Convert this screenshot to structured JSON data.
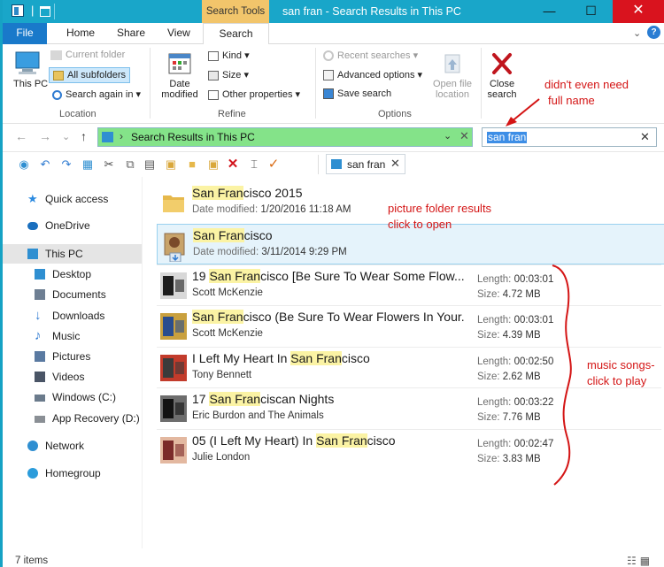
{
  "titlebar": {
    "context_tab": "Search Tools",
    "title": "san fran - Search Results in This PC",
    "minimize": "—",
    "maximize": "☐",
    "close": "✕"
  },
  "tabs": {
    "file": "File",
    "home": "Home",
    "share": "Share",
    "view": "View",
    "search": "Search",
    "expand": "⌄",
    "help": "?"
  },
  "ribbon": {
    "location": {
      "this_pc": "This PC",
      "this_pc_line2": "PC",
      "current_folder": "Current folder",
      "all_subfolders": "All subfolders",
      "search_again_in": "Search again in",
      "label": "Location"
    },
    "refine": {
      "date_modified": "Date",
      "date_modified_2": "modified",
      "kind": "Kind",
      "size": "Size",
      "other_properties": "Other properties",
      "label": "Refine"
    },
    "options": {
      "recent_searches": "Recent searches",
      "advanced_options": "Advanced options",
      "save_search": "Save search",
      "open_file_location": "Open file",
      "open_file_location_2": "location",
      "label": "Options"
    },
    "close": {
      "close_search": "Close",
      "close_search_2": "search"
    }
  },
  "address": {
    "path": "Search Results in This PC",
    "search_value": "san fran"
  },
  "doc_tab": {
    "label": "san fran"
  },
  "nav": {
    "items": [
      {
        "label": "Quick access",
        "icon": "star-icon",
        "color": "#2b8ae0"
      },
      {
        "label": "OneDrive",
        "icon": "cloud-icon",
        "color": "#1a6fbe"
      },
      {
        "label": "This PC",
        "icon": "computer-icon",
        "color": "#2f8fd1"
      },
      {
        "label": "Desktop",
        "icon": "desktop-icon",
        "color": "#2f8fd1"
      },
      {
        "label": "Documents",
        "icon": "documents-icon",
        "color": "#6e7f93"
      },
      {
        "label": "Downloads",
        "icon": "download-icon",
        "color": "#2f7bd1"
      },
      {
        "label": "Music",
        "icon": "music-icon",
        "color": "#2f7bd1"
      },
      {
        "label": "Pictures",
        "icon": "pictures-icon",
        "color": "#5a7aa1"
      },
      {
        "label": "Videos",
        "icon": "videos-icon",
        "color": "#4a5566"
      },
      {
        "label": "Windows (C:)",
        "icon": "drive-icon",
        "color": "#6b7b8c"
      },
      {
        "label": "App Recovery (D:)",
        "icon": "drive-icon",
        "color": "#8a8f95"
      },
      {
        "label": "Network",
        "icon": "network-icon",
        "color": "#2f8fd1"
      },
      {
        "label": "Homegroup",
        "icon": "homegroup-icon",
        "color": "#2b9cdb"
      }
    ]
  },
  "results": [
    {
      "title_pre": "",
      "title_hl": "San Fran",
      "title_post": "cisco 2015",
      "sub_label": "Date modified:",
      "sub_value": "1/20/2016 11:18 AM",
      "type": "folder"
    },
    {
      "title_pre": "",
      "title_hl": "San Fran",
      "title_post": "cisco",
      "sub_label": "Date modified:",
      "sub_value": "3/11/2014 9:29 PM",
      "type": "picture-folder"
    },
    {
      "title_pre": "19 ",
      "title_hl": "San Fran",
      "title_post": "cisco [Be Sure To Wear Some Flow...",
      "sub_label": "",
      "sub_value": "Scott McKenzie",
      "length": "00:03:01",
      "size": "4.72 MB",
      "type": "song"
    },
    {
      "title_pre": "",
      "title_hl": "San Fran",
      "title_post": "cisco (Be Sure To Wear Flowers In Your...",
      "sub_label": "",
      "sub_value": "Scott McKenzie",
      "length": "00:03:01",
      "size": "4.39 MB",
      "type": "song"
    },
    {
      "title_pre": "I Left My Heart In ",
      "title_hl": "San Fran",
      "title_post": "cisco",
      "sub_label": "",
      "sub_value": "Tony Bennett",
      "length": "00:02:50",
      "size": "2.62 MB",
      "type": "song"
    },
    {
      "title_pre": "17 ",
      "title_hl": "San Fran",
      "title_post": "ciscan Nights",
      "sub_label": "",
      "sub_value": "Eric Burdon and The Animals",
      "length": "00:03:22",
      "size": "7.76 MB",
      "type": "song"
    },
    {
      "title_pre": "05 (I Left My Heart) In ",
      "title_hl": "San Fran",
      "title_post": "cisco",
      "sub_label": "",
      "sub_value": "Julie London",
      "length": "00:02:47",
      "size": "3.83 MB",
      "type": "song"
    }
  ],
  "meta_labels": {
    "length": "Length:",
    "size": "Size:"
  },
  "status": {
    "count": "7 items"
  },
  "annotations": {
    "name": "didn't even need",
    "name_2": "full name",
    "folder": "picture folder results",
    "folder_2": "click to open",
    "songs": "music songs-",
    "songs_2": "click to play"
  },
  "colors": {
    "titlebar": "#19a6c9",
    "address_highlight": "#84e389",
    "match_highlight": "#fbf3a4",
    "annotation": "#d41515"
  }
}
